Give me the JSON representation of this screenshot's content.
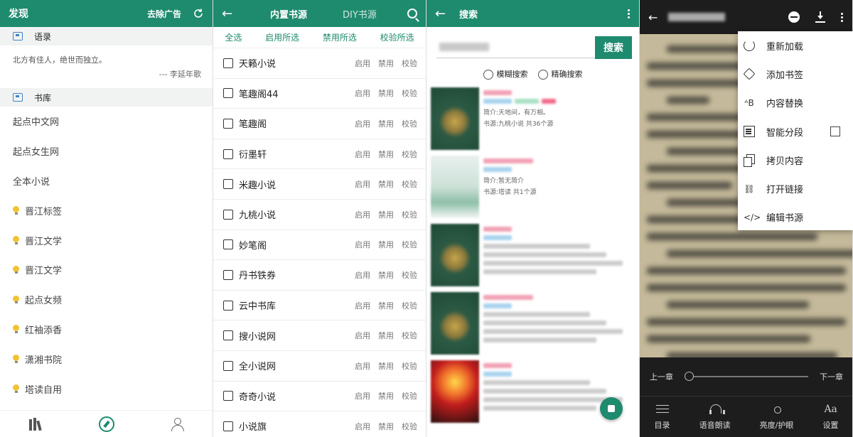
{
  "colors": {
    "accent": "#1e8a6e",
    "reader_bg": "#c4b99a",
    "reader_bar": "#1d1d1d"
  },
  "discover": {
    "title": "发现",
    "remove_ads": "去除广告",
    "refresh_icon": "refresh-icon",
    "quote_section": "语录",
    "quote_text": "北方有佳人，绝世而独立。",
    "quote_author": "--- 李延年歌",
    "library_section": "书库",
    "items": [
      {
        "label": "起点中文网",
        "bulb": false
      },
      {
        "label": "起点女生网",
        "bulb": false
      },
      {
        "label": "全本小说",
        "bulb": false
      },
      {
        "label": "晋江标签",
        "bulb": true
      },
      {
        "label": "晋江文学",
        "bulb": true
      },
      {
        "label": "晋江文学",
        "bulb": true
      },
      {
        "label": "起点女频",
        "bulb": true
      },
      {
        "label": "红袖添香",
        "bulb": true
      },
      {
        "label": "潇湘书院",
        "bulb": true
      },
      {
        "label": "塔读自用",
        "bulb": true
      }
    ],
    "nav": [
      "bookshelf-icon",
      "compass-icon",
      "user-icon"
    ]
  },
  "sources": {
    "tab_builtin": "内置书源",
    "tab_diy": "DIY书源",
    "actions": [
      "全选",
      "启用所选",
      "禁用所选",
      "校验所选"
    ],
    "op_enable": "启用",
    "op_disable": "禁用",
    "op_check": "校验",
    "list": [
      "天籁小说",
      "笔趣阁44",
      "笔趣阁",
      "衍墨轩",
      "米趣小说",
      "九桃小说",
      "妙笔阁",
      "丹书铁券",
      "云中书库",
      "搜小说网",
      "全小说网",
      "奇奇小说",
      "小说旗"
    ]
  },
  "search": {
    "title": "搜索",
    "button": "搜索",
    "fuzzy": "模糊搜索",
    "exact": "精确搜索",
    "results": [
      {
        "cover": "green",
        "desc": "简介:天地间，有万相。",
        "source": "书源:九桃小说 共36个源"
      },
      {
        "cover": "light",
        "desc": "简介:暂无简介",
        "source": "书源:塔读 共1个源"
      },
      {
        "cover": "green",
        "desc": "",
        "source": ""
      },
      {
        "cover": "green",
        "desc": "",
        "source": ""
      },
      {
        "cover": "fire",
        "desc": "",
        "source": ""
      }
    ]
  },
  "reader": {
    "menu": [
      {
        "label": "重新加载",
        "icon": "reload-icon"
      },
      {
        "label": "添加书签",
        "icon": "bookmark-tag-icon"
      },
      {
        "label": "内容替换",
        "icon": "replace-icon",
        "glyph": "ᴬB"
      },
      {
        "label": "智能分段",
        "icon": "paragraph-icon",
        "checkbox": true
      },
      {
        "label": "拷贝内容",
        "icon": "copy-icon"
      },
      {
        "label": "打开链接",
        "icon": "link-icon",
        "glyph": "⛓"
      },
      {
        "label": "编辑书源",
        "icon": "code-icon",
        "glyph": "</>"
      }
    ],
    "prev_chapter": "上一章",
    "next_chapter": "下一章",
    "bottom": [
      {
        "label": "目录",
        "icon": "list-icon"
      },
      {
        "label": "语音朗读",
        "icon": "headphones-icon"
      },
      {
        "label": "亮度/护眼",
        "icon": "brightness-icon"
      },
      {
        "label": "设置",
        "icon": "font-settings-icon",
        "glyph": "Aa"
      }
    ]
  }
}
